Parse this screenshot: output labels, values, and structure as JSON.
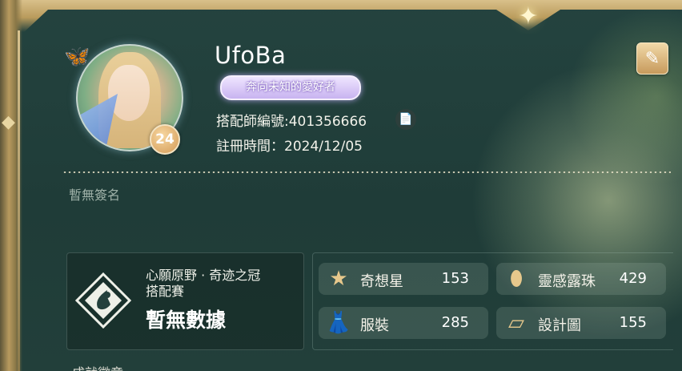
{
  "profile": {
    "username": "UfoBa",
    "title_badge": "奔向未知的愛好者",
    "level": "24",
    "stylist_id_label": "搭配師編號:",
    "stylist_id": "401356666",
    "register_label": "註冊時間：",
    "register_date": "2024/12/05",
    "signature": "暫無簽名"
  },
  "contest": {
    "title_line1": "心願原野 · 奇迹之冠",
    "title_line2": "搭配賽",
    "value": "暫無數據"
  },
  "stats": [
    {
      "label": "奇想星",
      "value": "153",
      "icon": "star-icon"
    },
    {
      "label": "靈感露珠",
      "value": "429",
      "icon": "dewdrop-icon"
    },
    {
      "label": "服裝",
      "value": "285",
      "icon": "clothes-icon"
    },
    {
      "label": "設計圖",
      "value": "155",
      "icon": "blueprint-icon"
    }
  ],
  "bottom_partial": "成就徽章",
  "colors": {
    "panel_bg": "#1f3a37",
    "gold_frame": "#b99b5c",
    "badge_purple": "#c8b3f0",
    "level_orange": "#d39a57"
  }
}
